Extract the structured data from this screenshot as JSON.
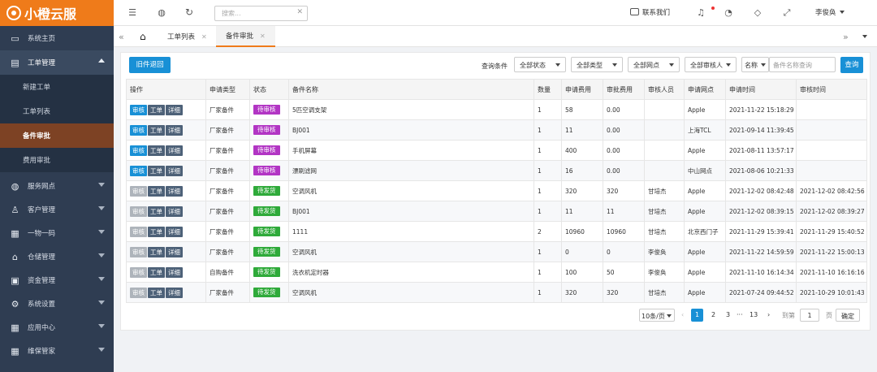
{
  "colors": {
    "brand": "#ef7b1a",
    "sidebar": "#2f3d52",
    "active_menu": "#7d4224",
    "primary": "#1890d6",
    "pending": "#b235c4",
    "shipping": "#2faa3a"
  },
  "logo": {
    "text": "小橙云服"
  },
  "sidebar": {
    "items": [
      {
        "label": "系统主页",
        "icon": "monitor-icon"
      },
      {
        "label": "工单管理",
        "icon": "document-icon",
        "children": [
          "新建工单",
          "工单列表",
          "备件审批",
          "费用审批"
        ]
      },
      {
        "label": "服务网点",
        "icon": "globe-icon"
      },
      {
        "label": "客户管理",
        "icon": "user-icon"
      },
      {
        "label": "一物一码",
        "icon": "grid-icon"
      },
      {
        "label": "仓储管理",
        "icon": "bank-icon"
      },
      {
        "label": "资金管理",
        "icon": "money-icon"
      },
      {
        "label": "系统设置",
        "icon": "gear-icon"
      },
      {
        "label": "应用中心",
        "icon": "apps-icon"
      },
      {
        "label": "维保管家",
        "icon": "apps-icon"
      }
    ]
  },
  "topbar": {
    "search_placeholder": "搜索...",
    "contact": "联系我们",
    "user": "李俊奂"
  },
  "tabs": [
    "工单列表",
    "备件审批"
  ],
  "toolbar": {
    "back_button": "旧件退回",
    "filter_label": "查询条件",
    "filters": [
      "全部状态",
      "全部类型",
      "全部网点",
      "全部审核人"
    ],
    "field_select": "名称",
    "search_placeholder": "备件名称查询",
    "query_button": "查询"
  },
  "table": {
    "headers": [
      "操作",
      "申请类型",
      "状态",
      "备件名称",
      "数量",
      "申请费用",
      "审批费用",
      "审核人员",
      "申请网点",
      "申请时间",
      "审核时间"
    ],
    "action_labels": [
      "审核",
      "工单",
      "详细"
    ],
    "rows": [
      {
        "type": "厂家备件",
        "status": "待审核",
        "name": "5匹空调支架",
        "qty": "1",
        "fee": "58",
        "approved": "0.00",
        "reviewer": "",
        "branch": "Apple",
        "apply_time": "2021-11-22 15:18:29",
        "review_time": ""
      },
      {
        "type": "厂家备件",
        "status": "待审核",
        "name": "BJ001",
        "qty": "1",
        "fee": "11",
        "approved": "0.00",
        "reviewer": "",
        "branch": "上海TCL",
        "apply_time": "2021-09-14 11:39:45",
        "review_time": ""
      },
      {
        "type": "厂家备件",
        "status": "待审核",
        "name": "手机屏幕",
        "qty": "1",
        "fee": "400",
        "approved": "0.00",
        "reviewer": "",
        "branch": "Apple",
        "apply_time": "2021-08-11 13:57:17",
        "review_time": ""
      },
      {
        "type": "厂家备件",
        "status": "待审核",
        "name": "漂刷滤网",
        "qty": "1",
        "fee": "16",
        "approved": "0.00",
        "reviewer": "",
        "branch": "中山网点",
        "apply_time": "2021-08-06 10:21:33",
        "review_time": ""
      },
      {
        "type": "厂家备件",
        "status": "待发货",
        "name": "空调风机",
        "qty": "1",
        "fee": "320",
        "approved": "320",
        "reviewer": "甘培杰",
        "branch": "Apple",
        "apply_time": "2021-12-02 08:42:48",
        "review_time": "2021-12-02 08:42:56"
      },
      {
        "type": "厂家备件",
        "status": "待发货",
        "name": "BJ001",
        "qty": "1",
        "fee": "11",
        "approved": "11",
        "reviewer": "甘培杰",
        "branch": "Apple",
        "apply_time": "2021-12-02 08:39:15",
        "review_time": "2021-12-02 08:39:27"
      },
      {
        "type": "厂家备件",
        "status": "待发货",
        "name": "1111",
        "qty": "2",
        "fee": "10960",
        "approved": "10960",
        "reviewer": "甘培杰",
        "branch": "北京西门子",
        "apply_time": "2021-11-29 15:39:41",
        "review_time": "2021-11-29 15:40:52"
      },
      {
        "type": "厂家备件",
        "status": "待发货",
        "name": "空调风机",
        "qty": "1",
        "fee": "0",
        "approved": "0",
        "reviewer": "李俊奂",
        "branch": "Apple",
        "apply_time": "2021-11-22 14:59:59",
        "review_time": "2021-11-22 15:00:13"
      },
      {
        "type": "自购备件",
        "status": "待发货",
        "name": "洗衣机定时器",
        "qty": "1",
        "fee": "100",
        "approved": "50",
        "reviewer": "李俊奂",
        "branch": "Apple",
        "apply_time": "2021-11-10 16:14:34",
        "review_time": "2021-11-10 16:16:16"
      },
      {
        "type": "厂家备件",
        "status": "待发货",
        "name": "空调风机",
        "qty": "1",
        "fee": "320",
        "approved": "320",
        "reviewer": "甘培杰",
        "branch": "Apple",
        "apply_time": "2021-07-24 09:44:52",
        "review_time": "2021-10-29 10:01:43"
      }
    ]
  },
  "pagination": {
    "page_size": "10条/页",
    "pages": [
      "1",
      "2",
      "3",
      "···",
      "13"
    ],
    "current": "1",
    "goto_label": "到第",
    "goto_value": "1",
    "page_suffix": "页",
    "confirm": "确定"
  }
}
